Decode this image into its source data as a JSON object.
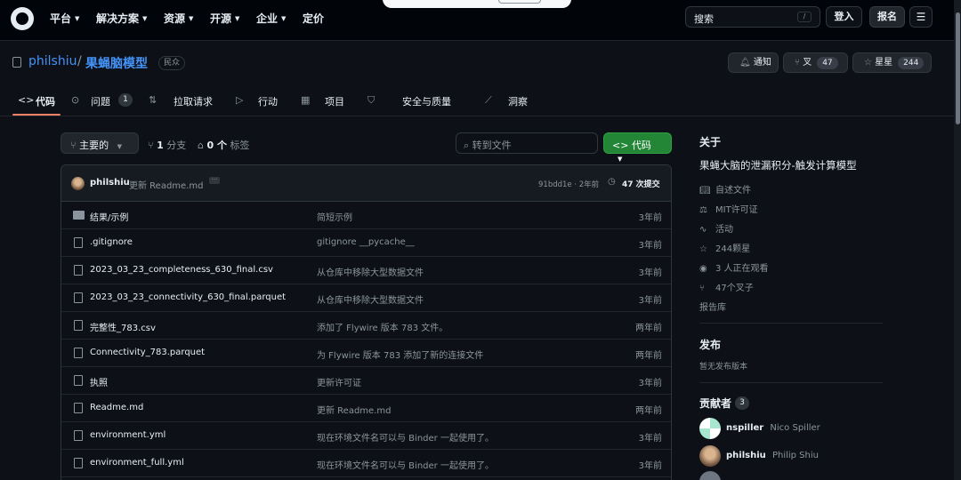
{
  "topnav": {
    "items": [
      "平台",
      "解决方案",
      "资源",
      "开源",
      "企业",
      "定价"
    ],
    "search_label": "搜索",
    "search_key": "/",
    "signin": "登入",
    "signup": "报名"
  },
  "repo": {
    "owner": "philshiu",
    "separator": "/",
    "name": "果蝇脑模型",
    "visibility": "民众",
    "notify_label": "通知",
    "fork_label": "叉",
    "fork_count": "47",
    "star_label": "星星",
    "star_count": "244"
  },
  "tabs": {
    "code": "代码",
    "issues": "问题",
    "issues_count": "1",
    "pulls": "拉取请求",
    "actions": "行动",
    "projects": "项目",
    "security": "安全与质量",
    "insights": "洞察"
  },
  "branchbar": {
    "branch": "主要的",
    "branches_count": "1",
    "branches_label": "分支",
    "tags_count": "0 个",
    "tags_label": "标签",
    "goto_file": "转到文件",
    "code_button": "代码"
  },
  "latest_commit": {
    "author": "philshiu",
    "message": "更新 Readme.md",
    "hash": "91bdd1e · 2年前",
    "commits": "47 次提交"
  },
  "files": [
    {
      "name": "结果/示例",
      "message": "简短示例",
      "date": "3年前",
      "type": "dir"
    },
    {
      "name": ".gitignore",
      "message": "gitignore __pycache__",
      "date": "3年前",
      "type": "file"
    },
    {
      "name": "2023_03_23_completeness_630_final.csv",
      "message": "从仓库中移除大型数据文件",
      "date": "3年前",
      "type": "file"
    },
    {
      "name": "2023_03_23_connectivity_630_final.parquet",
      "message": "从仓库中移除大型数据文件",
      "date": "3年前",
      "type": "file"
    },
    {
      "name": "完整性_783.csv",
      "message": "添加了 Flywire 版本 783 文件。",
      "date": "两年前",
      "type": "file"
    },
    {
      "name": "Connectivity_783.parquet",
      "message": "为 Flywire 版本 783 添加了新的连接文件",
      "date": "两年前",
      "type": "file"
    },
    {
      "name": "执照",
      "message": "更新许可证",
      "date": "3年前",
      "type": "file"
    },
    {
      "name": "Readme.md",
      "message": "更新 Readme.md",
      "date": "两年前",
      "type": "file"
    },
    {
      "name": "environment.yml",
      "message": "现在环境文件名可以与 Binder 一起使用了。",
      "date": "3年前",
      "type": "file"
    },
    {
      "name": "environment_full.yml",
      "message": "现在环境文件名可以与 Binder 一起使用了。",
      "date": "3年前",
      "type": "file"
    }
  ],
  "about": {
    "title": "关于",
    "description": "果蝇大脑的泄漏积分-触发计算模型",
    "readme": "自述文件",
    "license": "MIT许可证",
    "activity": "活动",
    "stars": "244颗星",
    "watching": "3 人正在观看",
    "forks": "47个叉子",
    "report": "报告库"
  },
  "releases": {
    "title": "发布",
    "empty": "暂无发布版本"
  },
  "contributors": {
    "title": "贡献者",
    "count": "3",
    "people": [
      {
        "login": "nspiller",
        "name": "Nico Spiller"
      },
      {
        "login": "philshiu",
        "name": "Philip Shiu"
      }
    ]
  }
}
